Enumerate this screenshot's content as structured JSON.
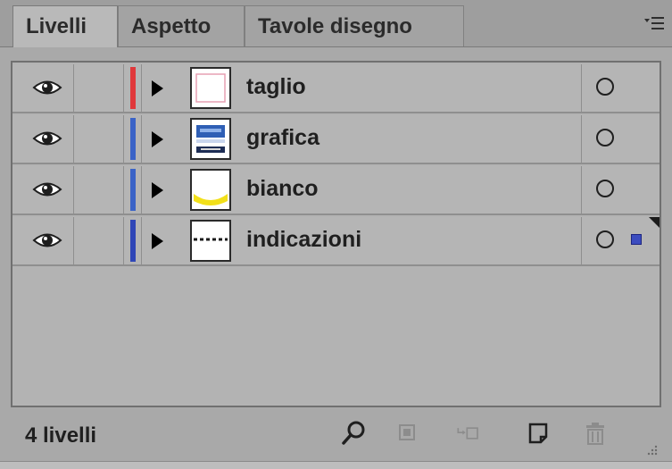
{
  "tabs": [
    {
      "label": "Livelli",
      "active": true
    },
    {
      "label": "Aspetto",
      "active": false
    },
    {
      "label": "Tavole disegno",
      "active": false
    }
  ],
  "panel_menu_icon": "panel-menu-icon",
  "layers": [
    {
      "name": "taglio",
      "color": "#e0383b",
      "thumb": "trim-outline-icon",
      "visible": true,
      "selected": false
    },
    {
      "name": "grafica",
      "color": "#3a63c7",
      "thumb": "graphic-artwork-icon",
      "visible": true,
      "selected": false
    },
    {
      "name": "bianco",
      "color": "#3a63c7",
      "thumb": "white-layer-yellow-arc-icon",
      "visible": true,
      "selected": false
    },
    {
      "name": "indicazioni",
      "color": "#2f46b7",
      "thumb": "dashed-line-icon",
      "visible": true,
      "selected": true
    }
  ],
  "footer": {
    "count_label": "4 livelli",
    "buttons": [
      "locate-object-icon",
      "make-clipping-mask-icon",
      "create-sublayer-icon",
      "new-layer-icon",
      "delete-layer-icon"
    ]
  },
  "colors": {
    "selection": "#3b4cbf"
  }
}
